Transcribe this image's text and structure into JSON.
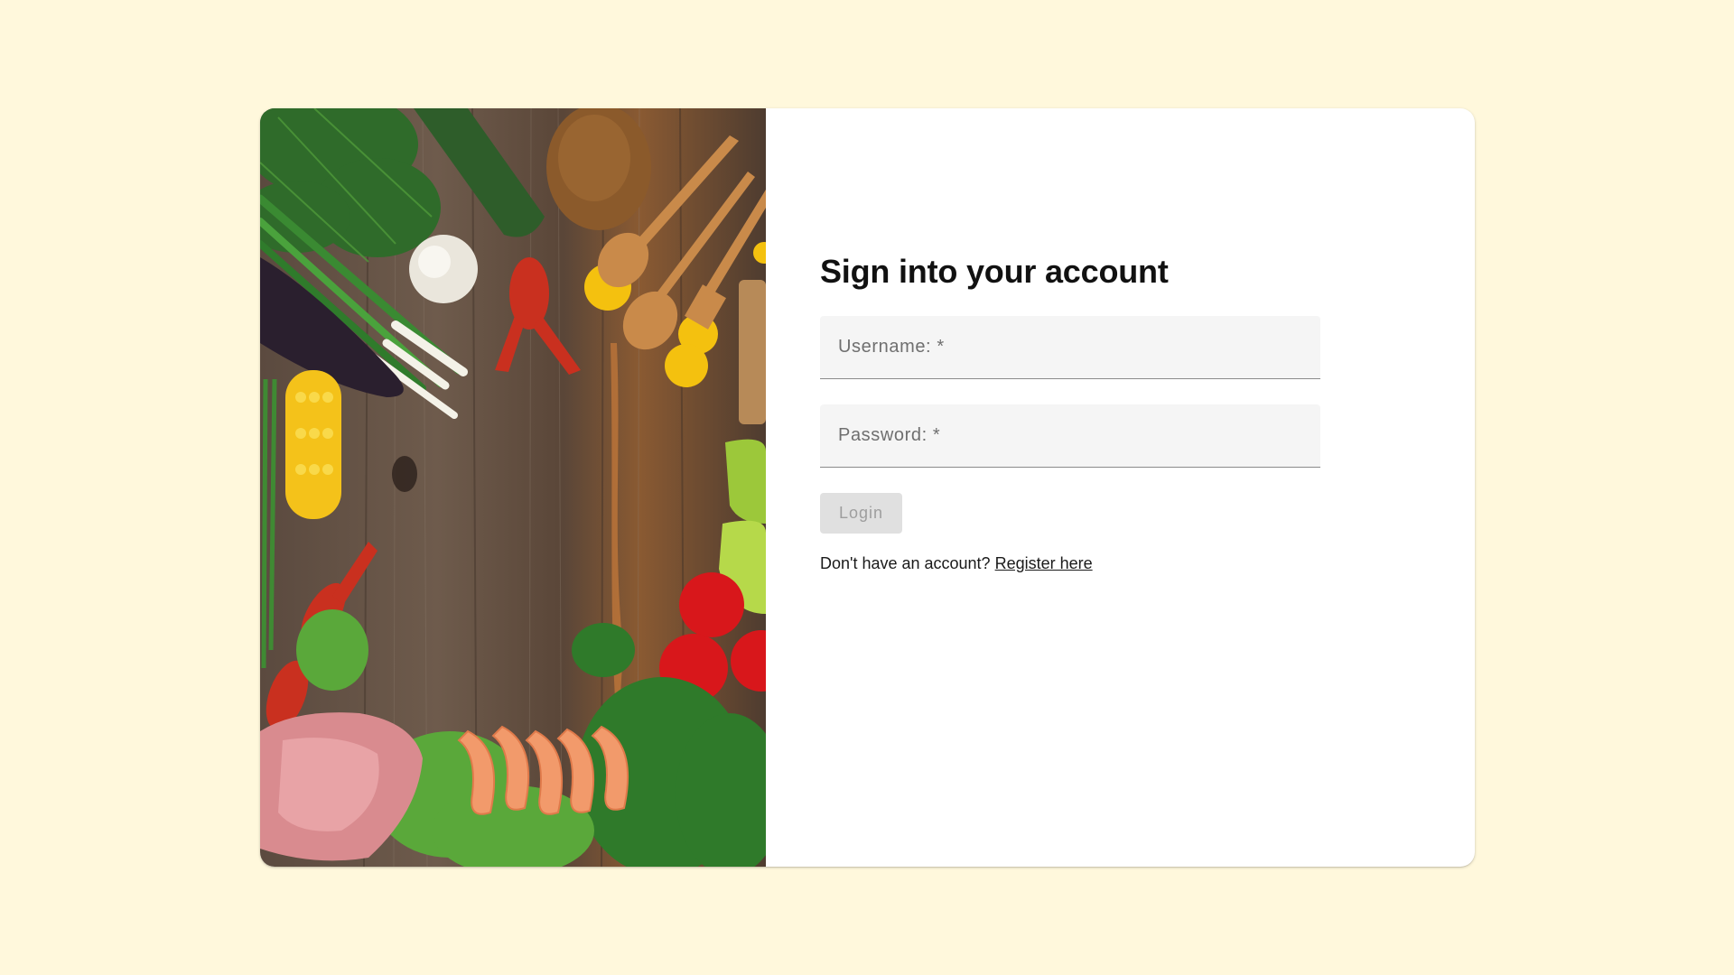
{
  "colors": {
    "page_background": "#fff8dc",
    "card_background": "#ffffff",
    "field_background": "#f5f5f5",
    "button_disabled_background": "#e0e0e0",
    "button_disabled_text": "#9e9e9e"
  },
  "hero_image": {
    "icon": "food-ingredients-photo"
  },
  "form": {
    "title": "Sign into your account",
    "username": {
      "placeholder": "Username: *",
      "value": ""
    },
    "password": {
      "placeholder": "Password: *",
      "value": ""
    },
    "login_label": "Login",
    "register_prompt": "Don't have an account?",
    "register_link": "Register here"
  }
}
